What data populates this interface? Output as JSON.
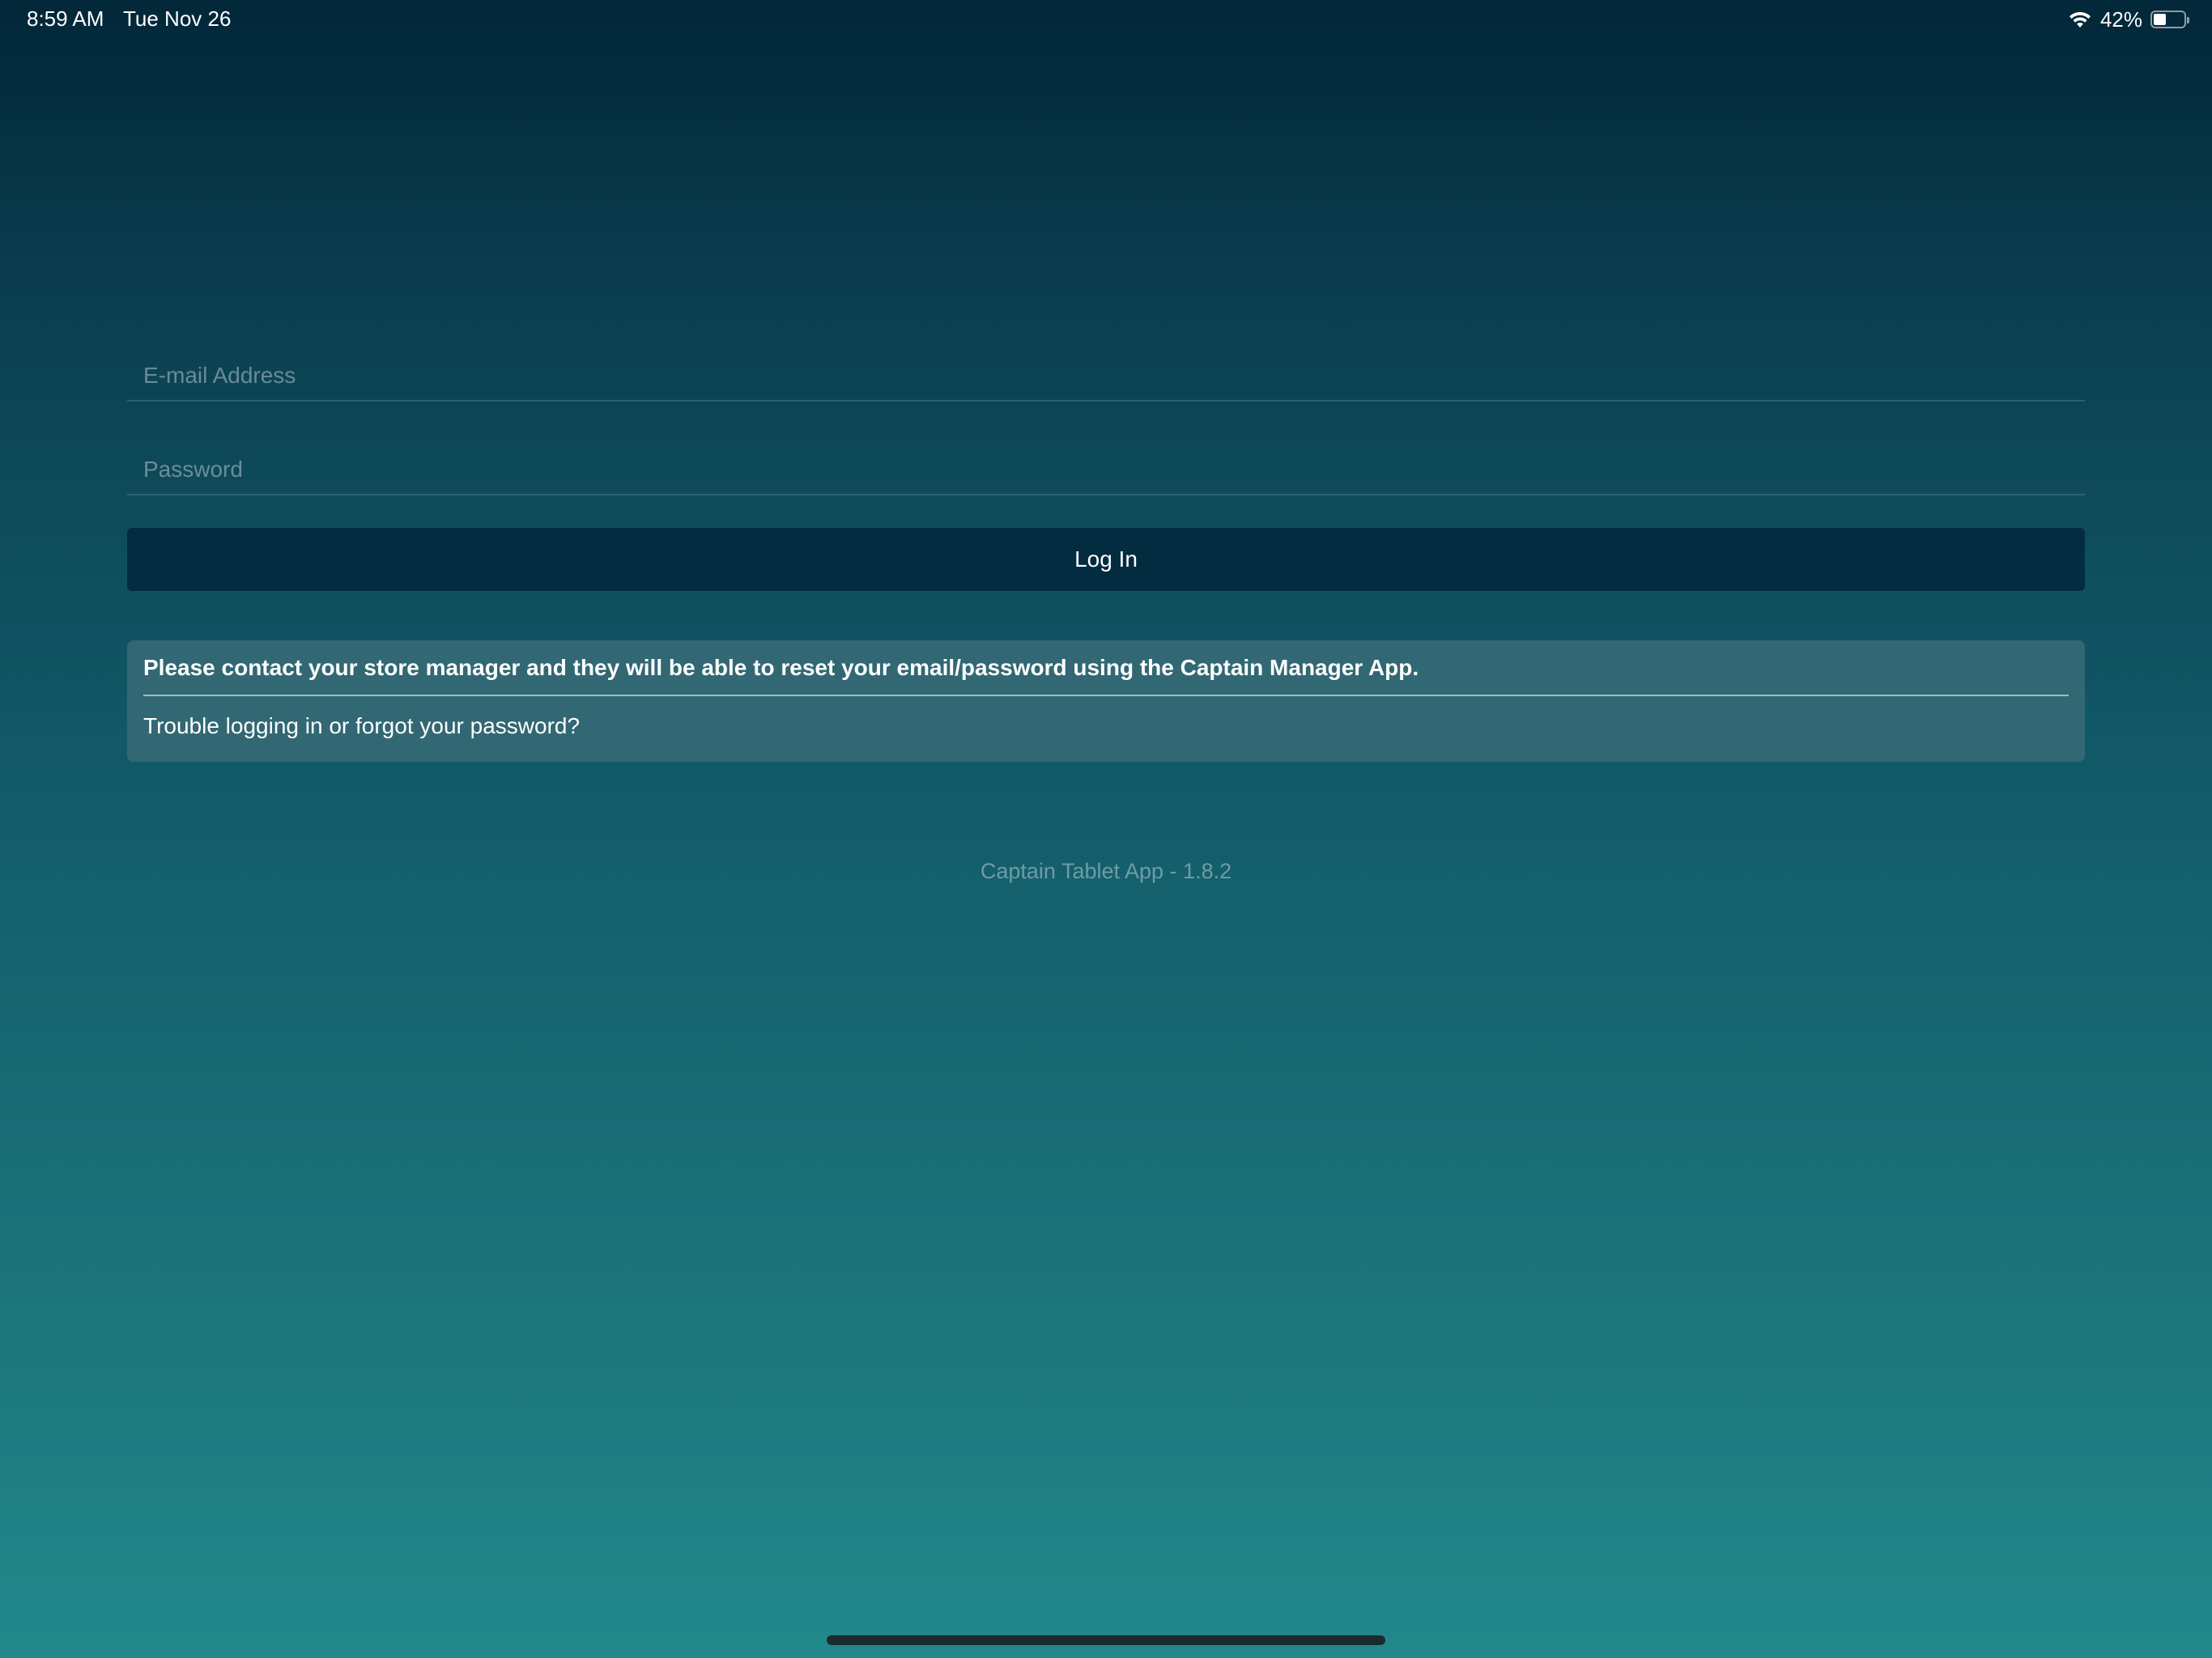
{
  "status_bar": {
    "time": "8:59 AM",
    "date": "Tue Nov 26",
    "battery_percent_label": "42%",
    "battery_level": 0.42,
    "wifi_icon": "wifi-icon",
    "battery_icon": "battery-icon"
  },
  "login": {
    "email_placeholder": "E-mail Address",
    "email_value": "",
    "password_placeholder": "Password",
    "password_value": "",
    "login_label": "Log In"
  },
  "help": {
    "message": "Please contact your store manager and they will be able to reset your email/password using the Captain Manager App.",
    "link_label": "Trouble logging in or forgot your password?"
  },
  "footer": {
    "version": "Captain Tablet App - 1.8.2"
  },
  "colors": {
    "background_top": "#022739",
    "background_bottom": "#21888b",
    "button": "#032c40",
    "help_panel": "#316873"
  }
}
